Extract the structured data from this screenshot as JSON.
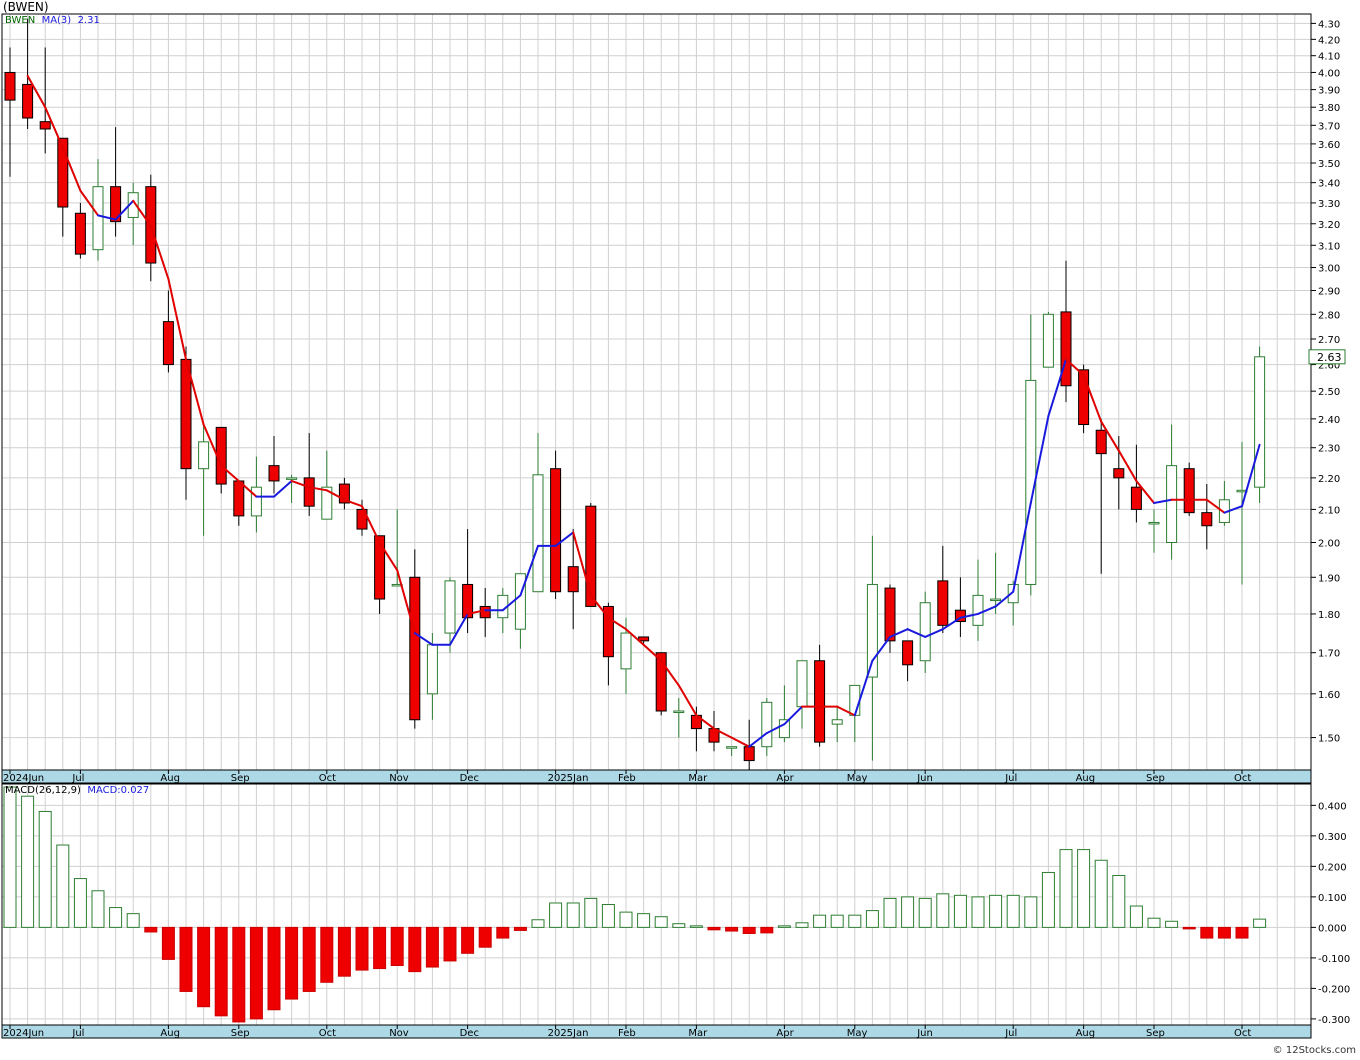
{
  "header": {
    "ticker_title": "(BWEN)",
    "price_legend": {
      "symbol": "BWEN",
      "ma_label": "MA(3)",
      "ma_value": "2.31"
    },
    "macd_legend": {
      "label": "MACD(26,12,9)",
      "value_label": "MACD:0.027"
    },
    "credit": "© 12Stocks.com"
  },
  "colors": {
    "up_candle": "#2e7d32",
    "down_candle": "#ee0000",
    "ma_rising": "#1a1adf",
    "ma_falling": "#e00000",
    "grid": "#d0d0d0",
    "axis_bar": "#add8e6",
    "last_price_box": "#2e7d32"
  },
  "chart_data": [
    {
      "type": "candlestick",
      "title": "(BWEN)",
      "y_scale": "log",
      "ylim": [
        1.43,
        4.36
      ],
      "y_ticks": [
        "4.30",
        "4.20",
        "4.10",
        "4.00",
        "3.90",
        "3.80",
        "3.70",
        "3.60",
        "3.50",
        "3.40",
        "3.30",
        "3.20",
        "3.10",
        "3.00",
        "2.90",
        "2.80",
        "2.70",
        "2.60",
        "2.50",
        "2.40",
        "2.30",
        "2.20",
        "2.10",
        "2.00",
        "1.90",
        "1.80",
        "1.70",
        "1.60",
        "1.50"
      ],
      "x_labels": [
        "2024Jun",
        "Jul",
        "Aug",
        "Sep",
        "Oct",
        "Nov",
        "Dec",
        "2025Jan",
        "Feb",
        "Mar",
        "Apr",
        "May",
        "Jun",
        "Jul",
        "Aug",
        "Sep",
        "Oct"
      ],
      "x_label_week_index": [
        0,
        4,
        9,
        13,
        18,
        22,
        26,
        31,
        35,
        39,
        44,
        48,
        52,
        57,
        61,
        65,
        70
      ],
      "last_price": "2.63",
      "candles": [
        {
          "o": 4.0,
          "h": 4.15,
          "l": 3.43,
          "c": 3.84
        },
        {
          "o": 3.93,
          "h": 4.33,
          "l": 3.68,
          "c": 3.74
        },
        {
          "o": 3.72,
          "h": 4.15,
          "l": 3.55,
          "c": 3.68
        },
        {
          "o": 3.63,
          "h": 3.63,
          "l": 3.14,
          "c": 3.28
        },
        {
          "o": 3.25,
          "h": 3.3,
          "l": 3.04,
          "c": 3.06
        },
        {
          "o": 3.08,
          "h": 3.52,
          "l": 3.03,
          "c": 3.38
        },
        {
          "o": 3.38,
          "h": 3.69,
          "l": 3.14,
          "c": 3.21
        },
        {
          "o": 3.23,
          "h": 3.4,
          "l": 3.1,
          "c": 3.35
        },
        {
          "o": 3.38,
          "h": 3.44,
          "l": 2.94,
          "c": 3.02
        },
        {
          "o": 2.77,
          "h": 2.9,
          "l": 2.57,
          "c": 2.6
        },
        {
          "o": 2.62,
          "h": 2.67,
          "l": 2.13,
          "c": 2.23
        },
        {
          "o": 2.23,
          "h": 2.38,
          "l": 2.02,
          "c": 2.32
        },
        {
          "o": 2.37,
          "h": 2.37,
          "l": 2.15,
          "c": 2.18
        },
        {
          "o": 2.19,
          "h": 2.19,
          "l": 2.05,
          "c": 2.08
        },
        {
          "o": 2.08,
          "h": 2.27,
          "l": 2.03,
          "c": 2.17
        },
        {
          "o": 2.24,
          "h": 2.34,
          "l": 2.15,
          "c": 2.19
        },
        {
          "o": 2.2,
          "h": 2.21,
          "l": 2.12,
          "c": 2.2
        },
        {
          "o": 2.2,
          "h": 2.35,
          "l": 2.08,
          "c": 2.11
        },
        {
          "o": 2.07,
          "h": 2.29,
          "l": 2.07,
          "c": 2.17
        },
        {
          "o": 2.18,
          "h": 2.2,
          "l": 2.1,
          "c": 2.12
        },
        {
          "o": 2.1,
          "h": 2.13,
          "l": 2.02,
          "c": 2.04
        },
        {
          "o": 2.02,
          "h": 2.02,
          "l": 1.8,
          "c": 1.84
        },
        {
          "o": 1.88,
          "h": 2.1,
          "l": 1.88,
          "c": 1.88
        },
        {
          "o": 1.9,
          "h": 1.98,
          "l": 1.52,
          "c": 1.54
        },
        {
          "o": 1.6,
          "h": 1.75,
          "l": 1.54,
          "c": 1.72
        },
        {
          "o": 1.75,
          "h": 1.9,
          "l": 1.7,
          "c": 1.89
        },
        {
          "o": 1.88,
          "h": 2.04,
          "l": 1.75,
          "c": 1.79
        },
        {
          "o": 1.82,
          "h": 1.87,
          "l": 1.74,
          "c": 1.79
        },
        {
          "o": 1.79,
          "h": 1.87,
          "l": 1.75,
          "c": 1.85
        },
        {
          "o": 1.76,
          "h": 1.91,
          "l": 1.71,
          "c": 1.91
        },
        {
          "o": 1.86,
          "h": 2.35,
          "l": 1.88,
          "c": 2.21
        },
        {
          "o": 2.23,
          "h": 2.29,
          "l": 1.84,
          "c": 1.86
        },
        {
          "o": 1.93,
          "h": 2.04,
          "l": 1.76,
          "c": 1.86
        },
        {
          "o": 2.11,
          "h": 2.12,
          "l": 1.82,
          "c": 1.82
        },
        {
          "o": 1.82,
          "h": 1.83,
          "l": 1.62,
          "c": 1.69
        },
        {
          "o": 1.66,
          "h": 1.79,
          "l": 1.6,
          "c": 1.75
        },
        {
          "o": 1.74,
          "h": 1.74,
          "l": 1.72,
          "c": 1.73
        },
        {
          "o": 1.7,
          "h": 1.7,
          "l": 1.55,
          "c": 1.56
        },
        {
          "o": 1.56,
          "h": 1.59,
          "l": 1.5,
          "c": 1.56
        },
        {
          "o": 1.55,
          "h": 1.57,
          "l": 1.47,
          "c": 1.52
        },
        {
          "o": 1.52,
          "h": 1.56,
          "l": 1.47,
          "c": 1.49
        },
        {
          "o": 1.48,
          "h": 1.48,
          "l": 1.46,
          "c": 1.48
        },
        {
          "o": 1.48,
          "h": 1.54,
          "l": 1.43,
          "c": 1.45
        },
        {
          "o": 1.48,
          "h": 1.59,
          "l": 1.46,
          "c": 1.58
        },
        {
          "o": 1.5,
          "h": 1.62,
          "l": 1.49,
          "c": 1.54
        },
        {
          "o": 1.57,
          "h": 1.68,
          "l": 1.52,
          "c": 1.68
        },
        {
          "o": 1.68,
          "h": 1.72,
          "l": 1.48,
          "c": 1.49
        },
        {
          "o": 1.53,
          "h": 1.57,
          "l": 1.49,
          "c": 1.54
        },
        {
          "o": 1.55,
          "h": 1.62,
          "l": 1.49,
          "c": 1.62
        },
        {
          "o": 1.64,
          "h": 2.02,
          "l": 1.45,
          "c": 1.88
        },
        {
          "o": 1.87,
          "h": 1.88,
          "l": 1.7,
          "c": 1.73
        },
        {
          "o": 1.73,
          "h": 1.73,
          "l": 1.63,
          "c": 1.67
        },
        {
          "o": 1.68,
          "h": 1.86,
          "l": 1.65,
          "c": 1.83
        },
        {
          "o": 1.89,
          "h": 1.99,
          "l": 1.75,
          "c": 1.77
        },
        {
          "o": 1.81,
          "h": 1.9,
          "l": 1.74,
          "c": 1.78
        },
        {
          "o": 1.77,
          "h": 1.95,
          "l": 1.73,
          "c": 1.85
        },
        {
          "o": 1.84,
          "h": 1.97,
          "l": 1.8,
          "c": 1.84
        },
        {
          "o": 1.83,
          "h": 1.89,
          "l": 1.77,
          "c": 1.88
        },
        {
          "o": 1.88,
          "h": 2.8,
          "l": 1.85,
          "c": 2.54
        },
        {
          "o": 2.59,
          "h": 2.81,
          "l": 2.59,
          "c": 2.8
        },
        {
          "o": 2.81,
          "h": 3.03,
          "l": 2.46,
          "c": 2.52
        },
        {
          "o": 2.58,
          "h": 2.6,
          "l": 2.35,
          "c": 2.38
        },
        {
          "o": 2.36,
          "h": 2.4,
          "l": 1.91,
          "c": 2.28
        },
        {
          "o": 2.23,
          "h": 2.34,
          "l": 2.1,
          "c": 2.2
        },
        {
          "o": 2.17,
          "h": 2.31,
          "l": 2.06,
          "c": 2.1
        },
        {
          "o": 2.06,
          "h": 2.1,
          "l": 1.97,
          "c": 2.06
        },
        {
          "o": 2.0,
          "h": 2.38,
          "l": 1.95,
          "c": 2.24
        },
        {
          "o": 2.23,
          "h": 2.25,
          "l": 2.08,
          "c": 2.09
        },
        {
          "o": 2.09,
          "h": 2.18,
          "l": 1.98,
          "c": 2.05
        },
        {
          "o": 2.06,
          "h": 2.19,
          "l": 2.05,
          "c": 2.13
        },
        {
          "o": 2.16,
          "h": 2.32,
          "l": 1.88,
          "c": 2.16
        },
        {
          "o": 2.17,
          "h": 2.67,
          "l": 2.12,
          "c": 2.63
        }
      ],
      "ma3": [
        null,
        3.98,
        3.8,
        3.58,
        3.36,
        3.24,
        3.22,
        3.31,
        3.19,
        2.95,
        2.62,
        2.38,
        2.24,
        2.19,
        2.14,
        2.14,
        2.19,
        2.17,
        2.16,
        2.13,
        2.11,
        2.0,
        1.92,
        1.75,
        1.72,
        1.72,
        1.8,
        1.81,
        1.81,
        1.85,
        1.99,
        1.99,
        2.03,
        1.85,
        1.79,
        1.76,
        1.72,
        1.68,
        1.62,
        1.55,
        1.52,
        1.5,
        1.48,
        1.51,
        1.53,
        1.57,
        1.57,
        1.57,
        1.55,
        1.68,
        1.74,
        1.76,
        1.74,
        1.76,
        1.79,
        1.8,
        1.82,
        1.86,
        2.12,
        2.41,
        2.62,
        2.56,
        2.39,
        2.29,
        2.19,
        2.12,
        2.13,
        2.13,
        2.13,
        2.09,
        2.11,
        2.31
      ],
      "ma_color": [
        "",
        "r",
        "r",
        "r",
        "r",
        "r",
        "b",
        "b",
        "r",
        "r",
        "r",
        "r",
        "r",
        "r",
        "r",
        "b",
        "b",
        "r",
        "r",
        "r",
        "r",
        "r",
        "r",
        "r",
        "b",
        "b",
        "b",
        "r",
        "b",
        "b",
        "b",
        "b",
        "b",
        "r",
        "r",
        "r",
        "r",
        "r",
        "r",
        "r",
        "r",
        "r",
        "r",
        "b",
        "b",
        "b",
        "r",
        "r",
        "r",
        "b",
        "b",
        "b",
        "b",
        "b",
        "b",
        "b",
        "b",
        "b",
        "b",
        "b",
        "b",
        "r",
        "r",
        "r",
        "r",
        "r",
        "b",
        "r",
        "r",
        "r",
        "b",
        "b"
      ]
    },
    {
      "type": "bar",
      "title": "MACD(26,12,9)",
      "ylim": [
        -0.32,
        0.47
      ],
      "y_ticks": [
        "0.400",
        "0.300",
        "0.200",
        "0.100",
        "0.000",
        "-0.100",
        "-0.200",
        "-0.300"
      ],
      "x_labels": [
        "2024Jun",
        "Jul",
        "Aug",
        "Sep",
        "Oct",
        "Nov",
        "Dec",
        "2025Jan",
        "Feb",
        "Mar",
        "Apr",
        "May",
        "Jun",
        "Jul",
        "Aug",
        "Sep",
        "Oct"
      ],
      "values": [
        0.46,
        0.43,
        0.38,
        0.27,
        0.16,
        0.12,
        0.065,
        0.045,
        -0.015,
        -0.105,
        -0.21,
        -0.26,
        -0.29,
        -0.31,
        -0.3,
        -0.27,
        -0.235,
        -0.21,
        -0.18,
        -0.16,
        -0.14,
        -0.135,
        -0.125,
        -0.145,
        -0.13,
        -0.11,
        -0.085,
        -0.065,
        -0.035,
        -0.01,
        0.025,
        0.08,
        0.08,
        0.095,
        0.075,
        0.05,
        0.045,
        0.035,
        0.012,
        0.005,
        -0.008,
        -0.012,
        -0.02,
        -0.018,
        0.005,
        0.015,
        0.04,
        0.04,
        0.04,
        0.055,
        0.095,
        0.1,
        0.095,
        0.11,
        0.105,
        0.1,
        0.105,
        0.105,
        0.1,
        0.18,
        0.255,
        0.255,
        0.22,
        0.17,
        0.07,
        0.03,
        0.02,
        -0.005,
        -0.035,
        -0.035,
        -0.035,
        0.027
      ]
    }
  ]
}
